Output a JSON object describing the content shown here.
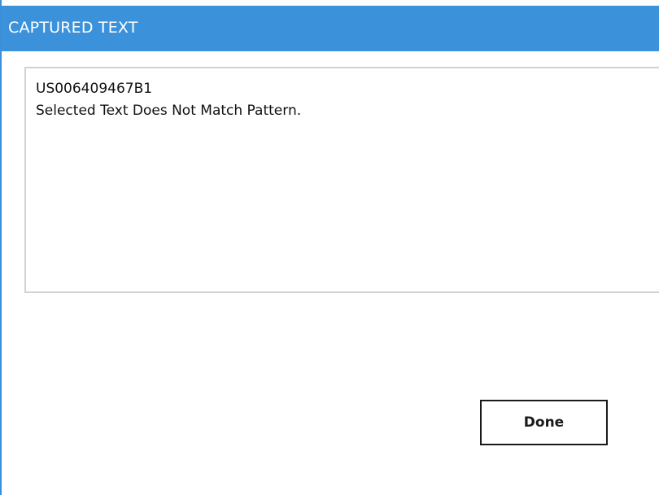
{
  "window": {
    "title": "CAPTURED TEXT"
  },
  "captured_text": {
    "line1": "US006409467B1",
    "line2": "Selected Text Does Not Match Pattern."
  },
  "actions": {
    "done_label": "Done"
  },
  "colors": {
    "titlebar": "#3b92db",
    "accent_border": "#3a8fdb",
    "textbox_border": "#d2d2d2",
    "button_border": "#1a1a1a"
  }
}
